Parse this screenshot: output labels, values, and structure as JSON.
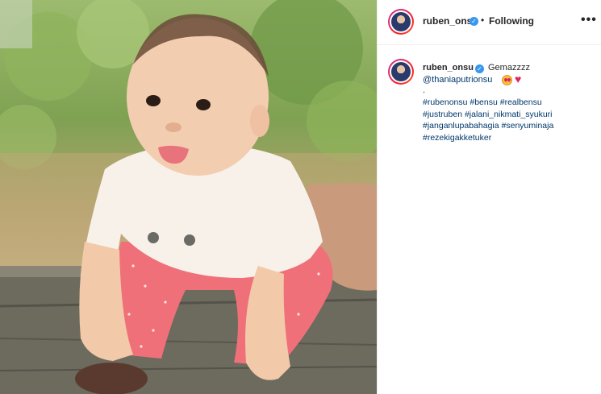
{
  "post": {
    "username": "ruben_onsu",
    "separator": "•",
    "follow_status": "Following",
    "more_label": "•••",
    "caption_text": "Gemazzzz",
    "mention": "@thaniaputrionsu",
    "caption_dot": ".",
    "hashtag_lines": [
      "#rubenonsu #bensu #realbensu",
      "#justruben #jalani_nikmati_syukuri",
      "#janganlupabahagia #senyuminaja",
      "#rezekigakketuker"
    ]
  },
  "icons": {
    "verified": "verified-badge-icon",
    "face_emoji": "heart-eyes-emoji-icon",
    "heart_emoji": "red-heart-emoji-icon",
    "more": "more-options-icon"
  },
  "colors": {
    "verified_blue": "#3897f0",
    "link_blue": "#00376b",
    "text": "#262626",
    "heart_red": "#e0245e"
  }
}
